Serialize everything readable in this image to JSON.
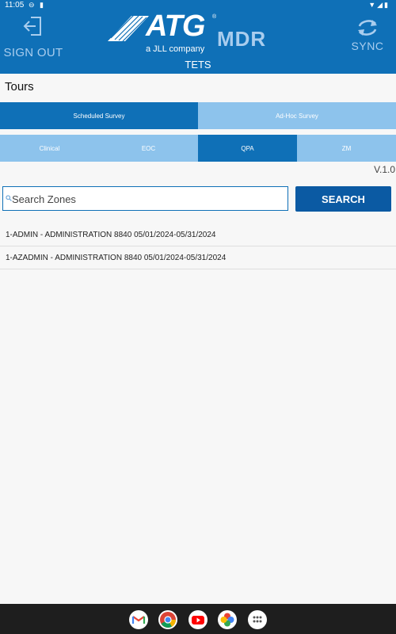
{
  "status_bar": {
    "time": "11:05"
  },
  "header": {
    "sign_out_label": "SIGN OUT",
    "logo_text": "ATG",
    "logo_mark": "®",
    "logo_sub": "MDR",
    "logo_tagline": "a JLL company",
    "sync_label": "SYNC",
    "page_title": "TETS"
  },
  "section_title": "Tours",
  "survey_tabs": [
    {
      "label": "Scheduled Survey",
      "active": true
    },
    {
      "label": "Ad-Hoc Survey",
      "active": false
    }
  ],
  "category_tabs": [
    {
      "label": "Clinical",
      "active": false
    },
    {
      "label": "EOC",
      "active": false
    },
    {
      "label": "QPA",
      "active": true
    },
    {
      "label": "ZM",
      "active": false
    }
  ],
  "version": "V.1.0",
  "search": {
    "placeholder": "Search Zones",
    "value": "",
    "button_label": "SEARCH"
  },
  "zones": [
    {
      "label": "1-ADMIN - ADMINISTRATION 8840 05/01/2024-05/31/2024"
    },
    {
      "label": "1-AZADMIN - ADMINISTRATION 8840 05/01/2024-05/31/2024"
    }
  ],
  "dock_apps": [
    "gmail-icon",
    "chrome-icon",
    "youtube-icon",
    "photos-icon",
    "app-drawer-icon"
  ],
  "colors": {
    "primary": "#0f70b7",
    "tab_inactive": "#8dc3ec",
    "button": "#0b5aa3",
    "label_light": "#a9cdee"
  }
}
